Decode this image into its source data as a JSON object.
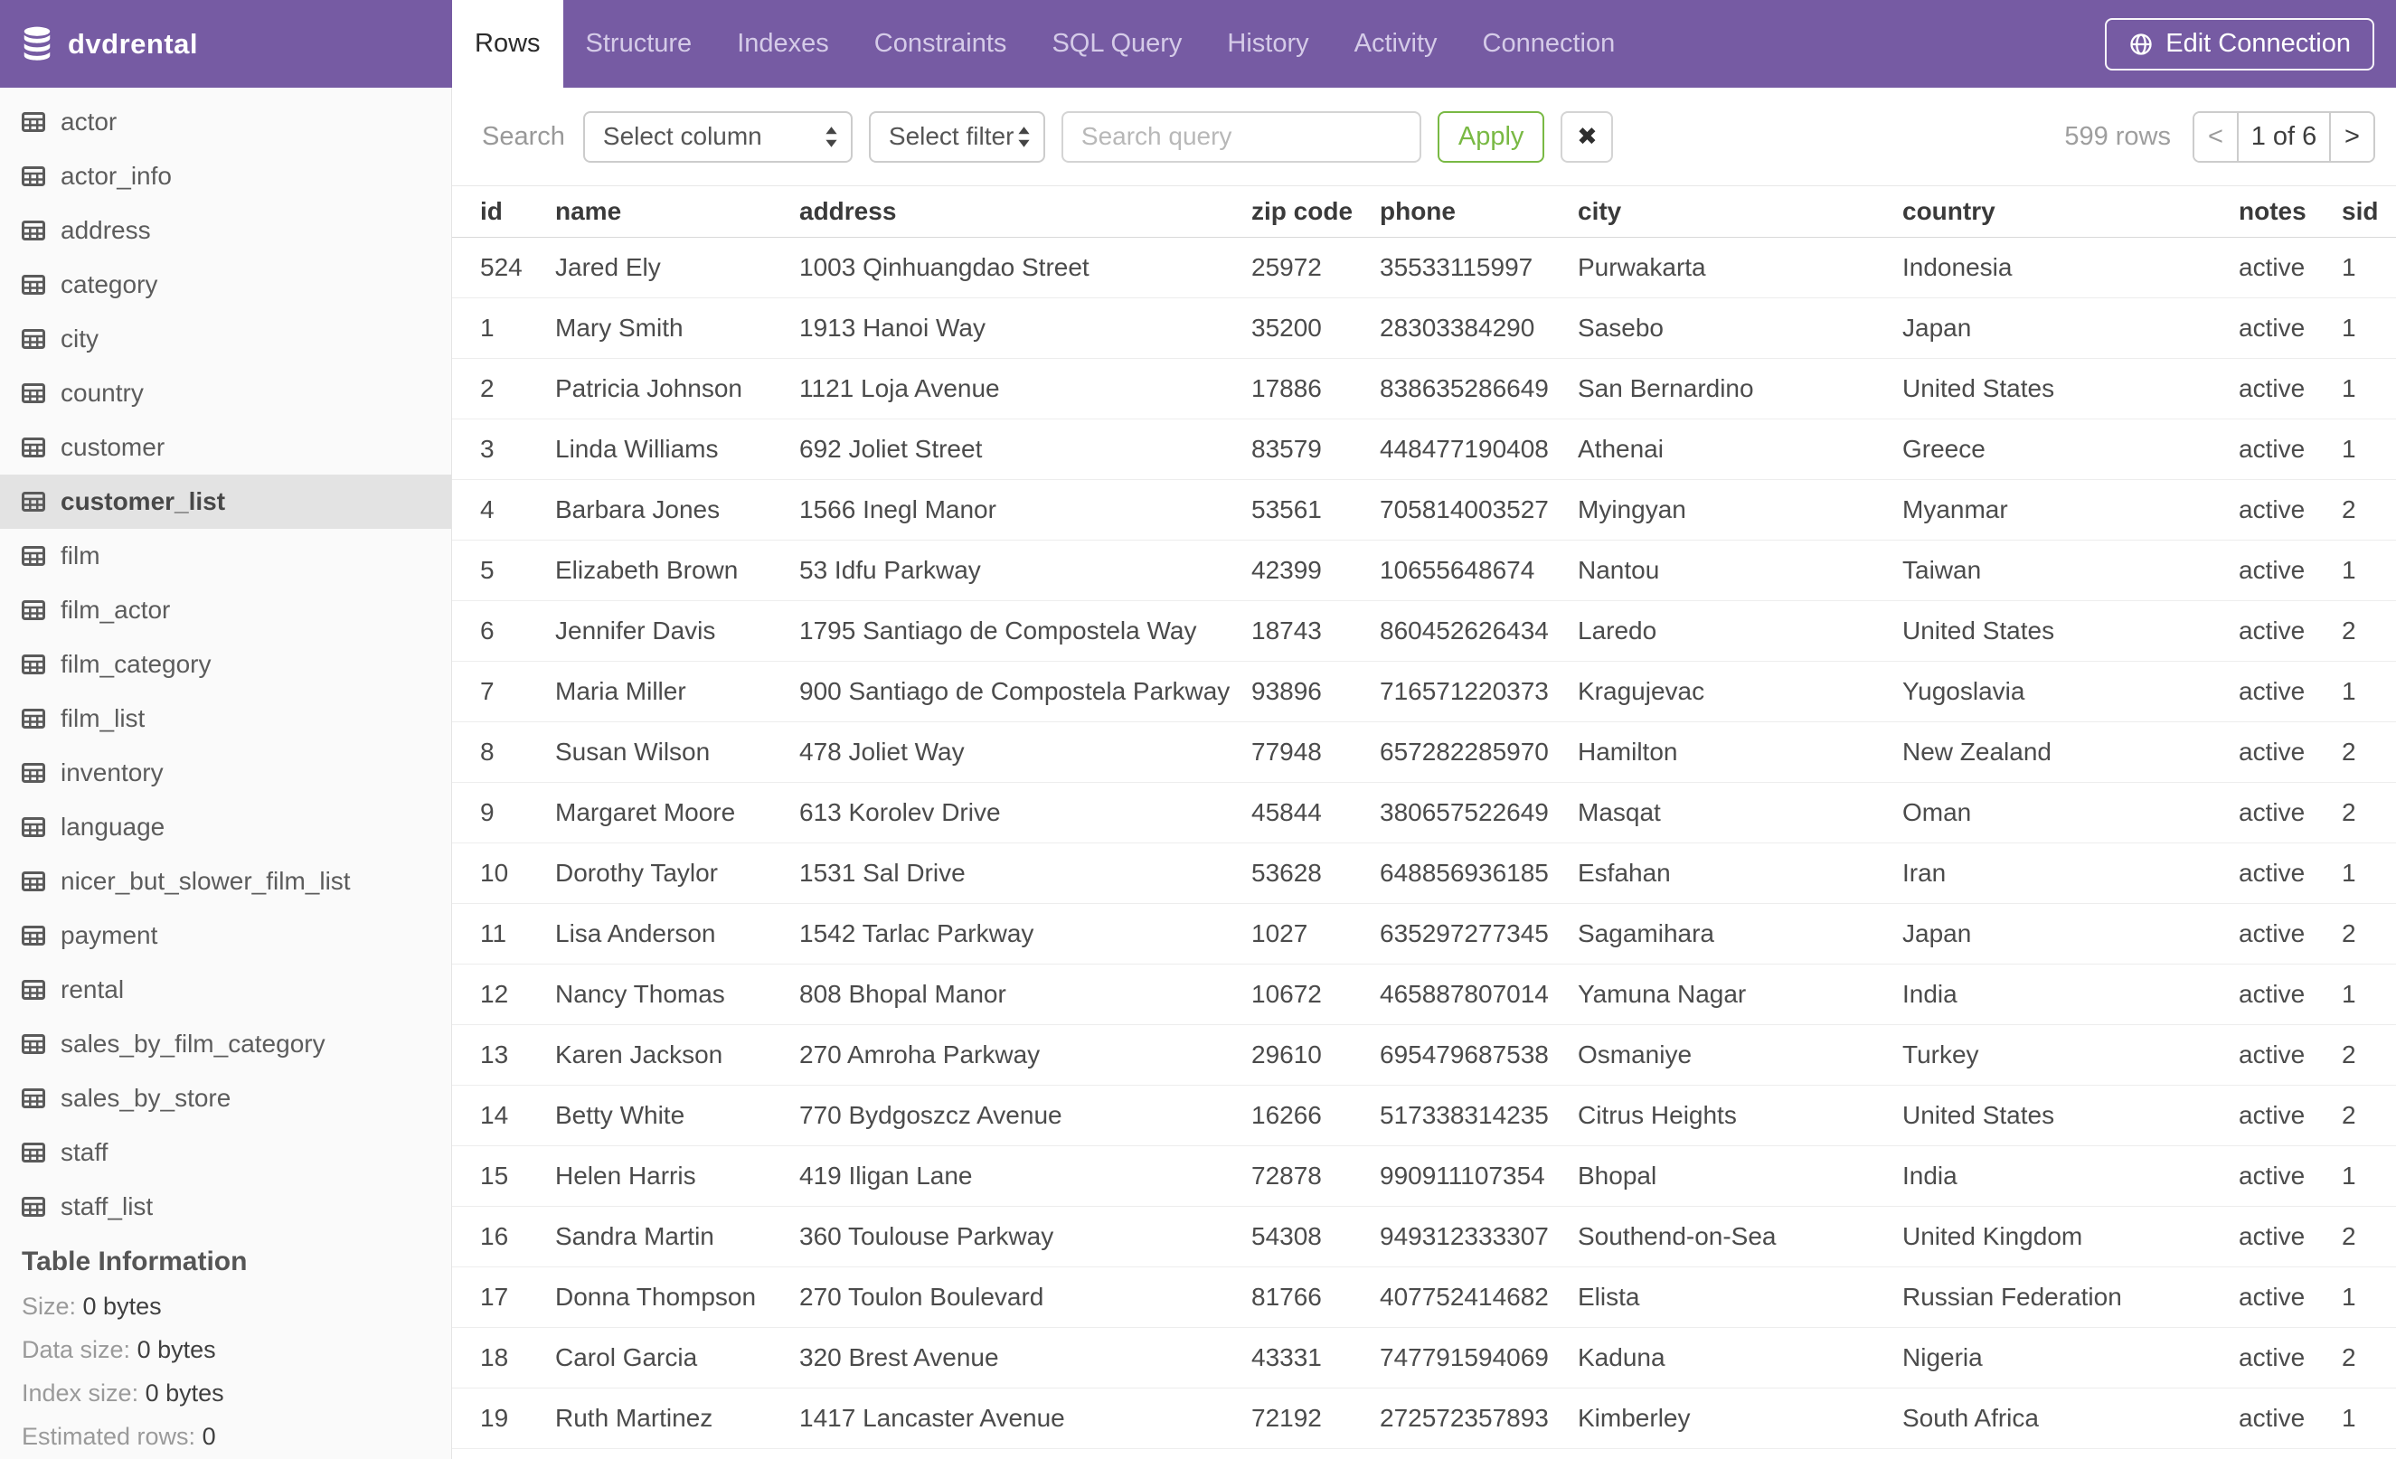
{
  "header": {
    "app_title": "dvdrental",
    "tabs": [
      {
        "label": "Rows",
        "active": true
      },
      {
        "label": "Structure",
        "active": false
      },
      {
        "label": "Indexes",
        "active": false
      },
      {
        "label": "Constraints",
        "active": false
      },
      {
        "label": "SQL Query",
        "active": false
      },
      {
        "label": "History",
        "active": false
      },
      {
        "label": "Activity",
        "active": false
      },
      {
        "label": "Connection",
        "active": false
      }
    ],
    "edit_connection_label": "Edit Connection"
  },
  "sidebar": {
    "tables": [
      "actor",
      "actor_info",
      "address",
      "category",
      "city",
      "country",
      "customer",
      "customer_list",
      "film",
      "film_actor",
      "film_category",
      "film_list",
      "inventory",
      "language",
      "nicer_but_slower_film_list",
      "payment",
      "rental",
      "sales_by_film_category",
      "sales_by_store",
      "staff",
      "staff_list"
    ],
    "selected": "customer_list",
    "info": {
      "heading": "Table Information",
      "rows": [
        {
          "label": "Size:",
          "value": "0 bytes"
        },
        {
          "label": "Data size:",
          "value": "0 bytes"
        },
        {
          "label": "Index size:",
          "value": "0 bytes"
        },
        {
          "label": "Estimated rows:",
          "value": "0"
        }
      ]
    }
  },
  "toolbar": {
    "search_label": "Search",
    "column_select": "Select column",
    "filter_select": "Select filter",
    "query_placeholder": "Search query",
    "apply_label": "Apply",
    "clear_label": "✖",
    "row_count": "599 rows",
    "pagination": {
      "prev": "<",
      "current": "1 of 6",
      "next": ">"
    }
  },
  "table": {
    "columns": [
      "id",
      "name",
      "address",
      "zip code",
      "phone",
      "city",
      "country",
      "notes",
      "sid"
    ],
    "rows": [
      [
        "524",
        "Jared Ely",
        "1003 Qinhuangdao Street",
        "25972",
        "35533115997",
        "Purwakarta",
        "Indonesia",
        "active",
        "1"
      ],
      [
        "1",
        "Mary Smith",
        "1913 Hanoi Way",
        "35200",
        "28303384290",
        "Sasebo",
        "Japan",
        "active",
        "1"
      ],
      [
        "2",
        "Patricia Johnson",
        "1121 Loja Avenue",
        "17886",
        "838635286649",
        "San Bernardino",
        "United States",
        "active",
        "1"
      ],
      [
        "3",
        "Linda Williams",
        "692 Joliet Street",
        "83579",
        "448477190408",
        "Athenai",
        "Greece",
        "active",
        "1"
      ],
      [
        "4",
        "Barbara Jones",
        "1566 Inegl Manor",
        "53561",
        "705814003527",
        "Myingyan",
        "Myanmar",
        "active",
        "2"
      ],
      [
        "5",
        "Elizabeth Brown",
        "53 Idfu Parkway",
        "42399",
        "10655648674",
        "Nantou",
        "Taiwan",
        "active",
        "1"
      ],
      [
        "6",
        "Jennifer Davis",
        "1795 Santiago de Compostela Way",
        "18743",
        "860452626434",
        "Laredo",
        "United States",
        "active",
        "2"
      ],
      [
        "7",
        "Maria Miller",
        "900 Santiago de Compostela Parkway",
        "93896",
        "716571220373",
        "Kragujevac",
        "Yugoslavia",
        "active",
        "1"
      ],
      [
        "8",
        "Susan Wilson",
        "478 Joliet Way",
        "77948",
        "657282285970",
        "Hamilton",
        "New Zealand",
        "active",
        "2"
      ],
      [
        "9",
        "Margaret Moore",
        "613 Korolev Drive",
        "45844",
        "380657522649",
        "Masqat",
        "Oman",
        "active",
        "2"
      ],
      [
        "10",
        "Dorothy Taylor",
        "1531 Sal Drive",
        "53628",
        "648856936185",
        "Esfahan",
        "Iran",
        "active",
        "1"
      ],
      [
        "11",
        "Lisa Anderson",
        "1542 Tarlac Parkway",
        "1027",
        "635297277345",
        "Sagamihara",
        "Japan",
        "active",
        "2"
      ],
      [
        "12",
        "Nancy Thomas",
        "808 Bhopal Manor",
        "10672",
        "465887807014",
        "Yamuna Nagar",
        "India",
        "active",
        "1"
      ],
      [
        "13",
        "Karen Jackson",
        "270 Amroha Parkway",
        "29610",
        "695479687538",
        "Osmaniye",
        "Turkey",
        "active",
        "2"
      ],
      [
        "14",
        "Betty White",
        "770 Bydgoszcz Avenue",
        "16266",
        "517338314235",
        "Citrus Heights",
        "United States",
        "active",
        "2"
      ],
      [
        "15",
        "Helen Harris",
        "419 Iligan Lane",
        "72878",
        "990911107354",
        "Bhopal",
        "India",
        "active",
        "1"
      ],
      [
        "16",
        "Sandra Martin",
        "360 Toulouse Parkway",
        "54308",
        "949312333307",
        "Southend-on-Sea",
        "United Kingdom",
        "active",
        "2"
      ],
      [
        "17",
        "Donna Thompson",
        "270 Toulon Boulevard",
        "81766",
        "407752414682",
        "Elista",
        "Russian Federation",
        "active",
        "1"
      ],
      [
        "18",
        "Carol Garcia",
        "320 Brest Avenue",
        "43331",
        "747791594069",
        "Kaduna",
        "Nigeria",
        "active",
        "2"
      ],
      [
        "19",
        "Ruth Martinez",
        "1417 Lancaster Avenue",
        "72192",
        "272572357893",
        "Kimberley",
        "South Africa",
        "active",
        "1"
      ]
    ]
  },
  "colors": {
    "brand_purple": "#765ba3",
    "tab_inactive_text": "#d5cbe8",
    "apply_green": "#79b944",
    "selected_item_bg": "#e3e3e3"
  }
}
